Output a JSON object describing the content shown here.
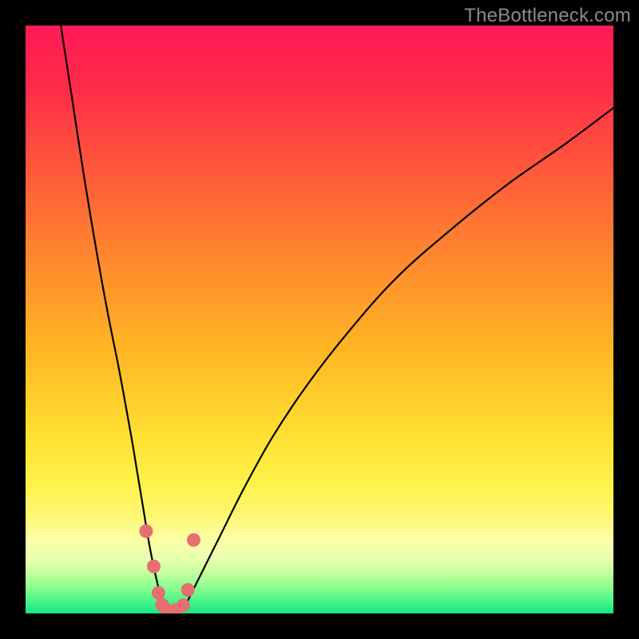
{
  "watermark": "TheBottleneck.com",
  "colors": {
    "frame": "#000000",
    "curve_stroke": "#000000",
    "points_fill": "#e76f6f",
    "points_stroke": "#c94f4f",
    "gradient_stops": [
      {
        "offset": 0.0,
        "color": "#ff1a55"
      },
      {
        "offset": 0.1,
        "color": "#ff2a4a"
      },
      {
        "offset": 0.25,
        "color": "#ff5a3a"
      },
      {
        "offset": 0.4,
        "color": "#ff8a2e"
      },
      {
        "offset": 0.55,
        "color": "#ffb524"
      },
      {
        "offset": 0.7,
        "color": "#ffe033"
      },
      {
        "offset": 0.78,
        "color": "#fff24a"
      },
      {
        "offset": 0.835,
        "color": "#fff775"
      },
      {
        "offset": 0.875,
        "color": "#fcffa6"
      },
      {
        "offset": 0.905,
        "color": "#e9ffaf"
      },
      {
        "offset": 0.93,
        "color": "#c6ff9f"
      },
      {
        "offset": 0.955,
        "color": "#8cff8f"
      },
      {
        "offset": 0.978,
        "color": "#4cf58a"
      },
      {
        "offset": 1.0,
        "color": "#15e887"
      }
    ]
  },
  "chart_data": {
    "type": "line",
    "title": "",
    "xlabel": "",
    "ylabel": "",
    "xlim": [
      0,
      100
    ],
    "ylim": [
      0,
      100
    ],
    "series": [
      {
        "name": "bottleneck-curve",
        "x": [
          6,
          8,
          10,
          12,
          14,
          16,
          18,
          19,
          20,
          21,
          22,
          23,
          24,
          25,
          26,
          27,
          28,
          30,
          33,
          37,
          42,
          48,
          55,
          63,
          72,
          82,
          92,
          100
        ],
        "y": [
          100,
          87,
          74,
          62,
          51,
          41,
          30,
          24,
          18,
          12,
          7,
          3,
          1,
          0.5,
          0.5,
          1,
          3,
          7,
          13,
          21,
          30,
          39,
          48,
          57,
          65,
          73,
          80,
          86
        ]
      }
    ],
    "points": {
      "name": "highlighted-points",
      "x": [
        20.5,
        21.8,
        22.6,
        23.2,
        24.0,
        25.4,
        26.8,
        27.6,
        28.6
      ],
      "y": [
        14.0,
        8.0,
        3.5,
        1.5,
        0.6,
        0.6,
        1.4,
        4.0,
        12.5
      ]
    }
  }
}
